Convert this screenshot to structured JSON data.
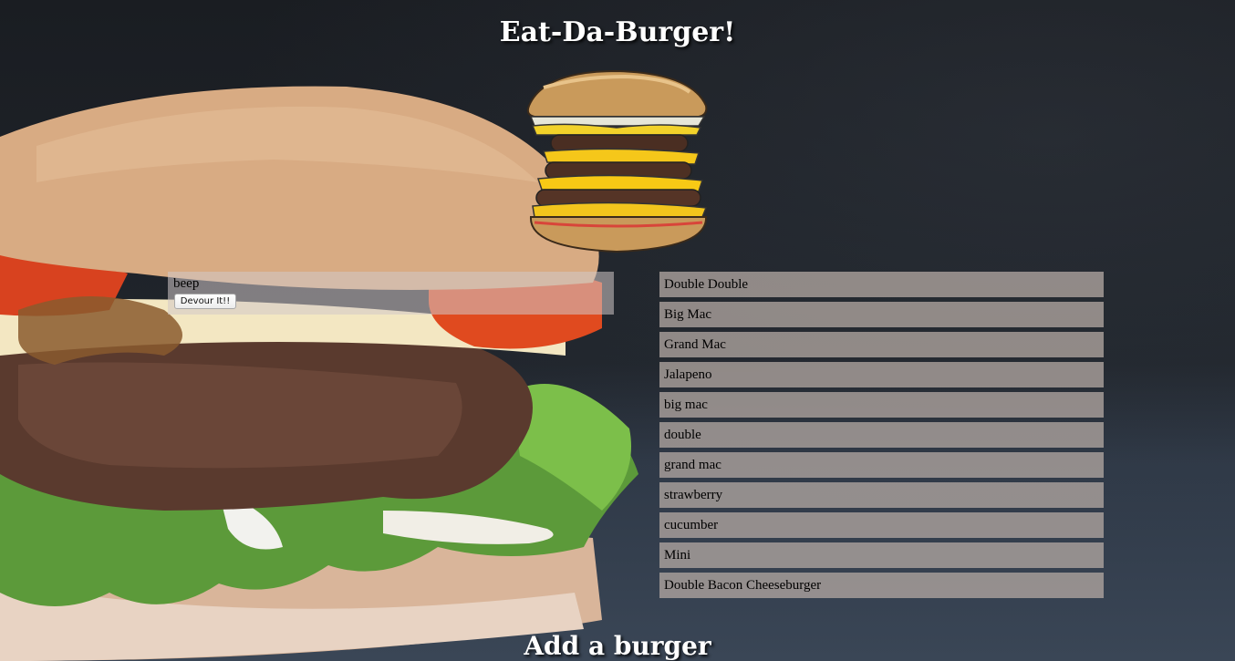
{
  "header": {
    "title": "Eat-Da-Burger!"
  },
  "uneaten": {
    "items": [
      {
        "name": "beep",
        "button_label": "Devour It!!"
      }
    ]
  },
  "eaten": {
    "items": [
      "Double Double",
      "Big Mac",
      "Grand Mac",
      "Jalapeno",
      "big mac",
      "double",
      "grand mac",
      "strawberry",
      "cucumber",
      "Mini",
      "Double Bacon Cheeseburger"
    ]
  },
  "form": {
    "heading": "Add a burger"
  },
  "icons": {
    "logo": "cartoon-burger-icon",
    "background": "burger-photo"
  }
}
